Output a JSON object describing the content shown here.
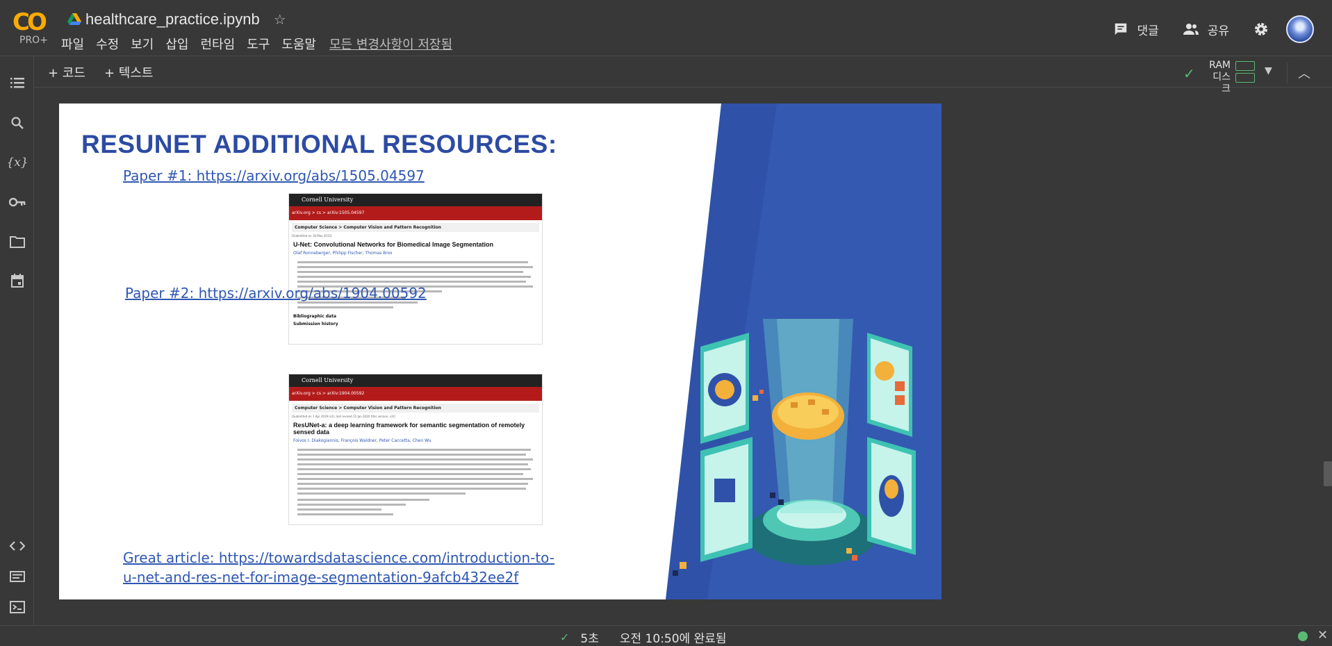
{
  "app": {
    "logo_text": "CO",
    "logo_badge": "PRO+",
    "notebook_title": "healthcare_practice.ipynb",
    "menu": [
      "파일",
      "수정",
      "보기",
      "삽입",
      "런타임",
      "도구",
      "도움말"
    ],
    "save_status": "모든 변경사항이 저장됨",
    "comment_label": "댓글",
    "share_label": "공유"
  },
  "toolbar": {
    "add_code": "+ 코드",
    "add_text": "+ 텍스트",
    "ram_label": "RAM",
    "disk_label": "디스크"
  },
  "sidebar": {
    "items": [
      "table-of-contents",
      "search",
      "variables",
      "secrets",
      "files",
      "calendar"
    ],
    "bottom_items": [
      "code-snippets",
      "command-palette",
      "terminal"
    ]
  },
  "slide": {
    "title": "RESUNET ADDITIONAL RESOURCES:",
    "paper1": "Paper #1: https://arxiv.org/abs/1505.04597",
    "paper2": "Paper #2: https://arxiv.org/abs/1904.00592",
    "article_line1": "Great article: https://towardsdatascience.com/introduction-to-",
    "article_line2": "u-net-and-res-net-for-image-segmentation-9afcb432ee2f",
    "shot1": {
      "header": "Cornell University",
      "crumb": "arXiv.org > cs > arXiv:1505.04597",
      "category": "Computer Science > Computer Vision and Pattern Recognition",
      "submitted": "[Submitted on 18 May 2015]",
      "paper_title": "U-Net: Convolutional Networks for Biomedical Image Segmentation",
      "authors": "Olaf Ronneberger, Philipp Fischer, Thomas Brox",
      "section1": "Bibliographic data",
      "section2": "Submission history"
    },
    "shot2": {
      "header": "Cornell University",
      "crumb": "arXiv.org > cs > arXiv:1904.00592",
      "category": "Computer Science > Computer Vision and Pattern Recognition",
      "submitted": "[Submitted on 1 Apr 2019 (v1), last revised 15 Jan 2020 (this version, v3)]",
      "paper_title": "ResUNet-a: a deep learning framework for semantic segmentation of remotely sensed data",
      "authors": "Foivos I. Diakogiannis, François Waldner, Peter Caccetta, Chen Wu"
    }
  },
  "status": {
    "duration": "5초",
    "completed": "오전 10:50에 완료됨"
  },
  "colors": {
    "background": "#383838",
    "accent_green": "#5bb974",
    "slide_title": "#2c4ba3",
    "link": "#2f57b2",
    "slide_blue": "#2f52a8"
  }
}
